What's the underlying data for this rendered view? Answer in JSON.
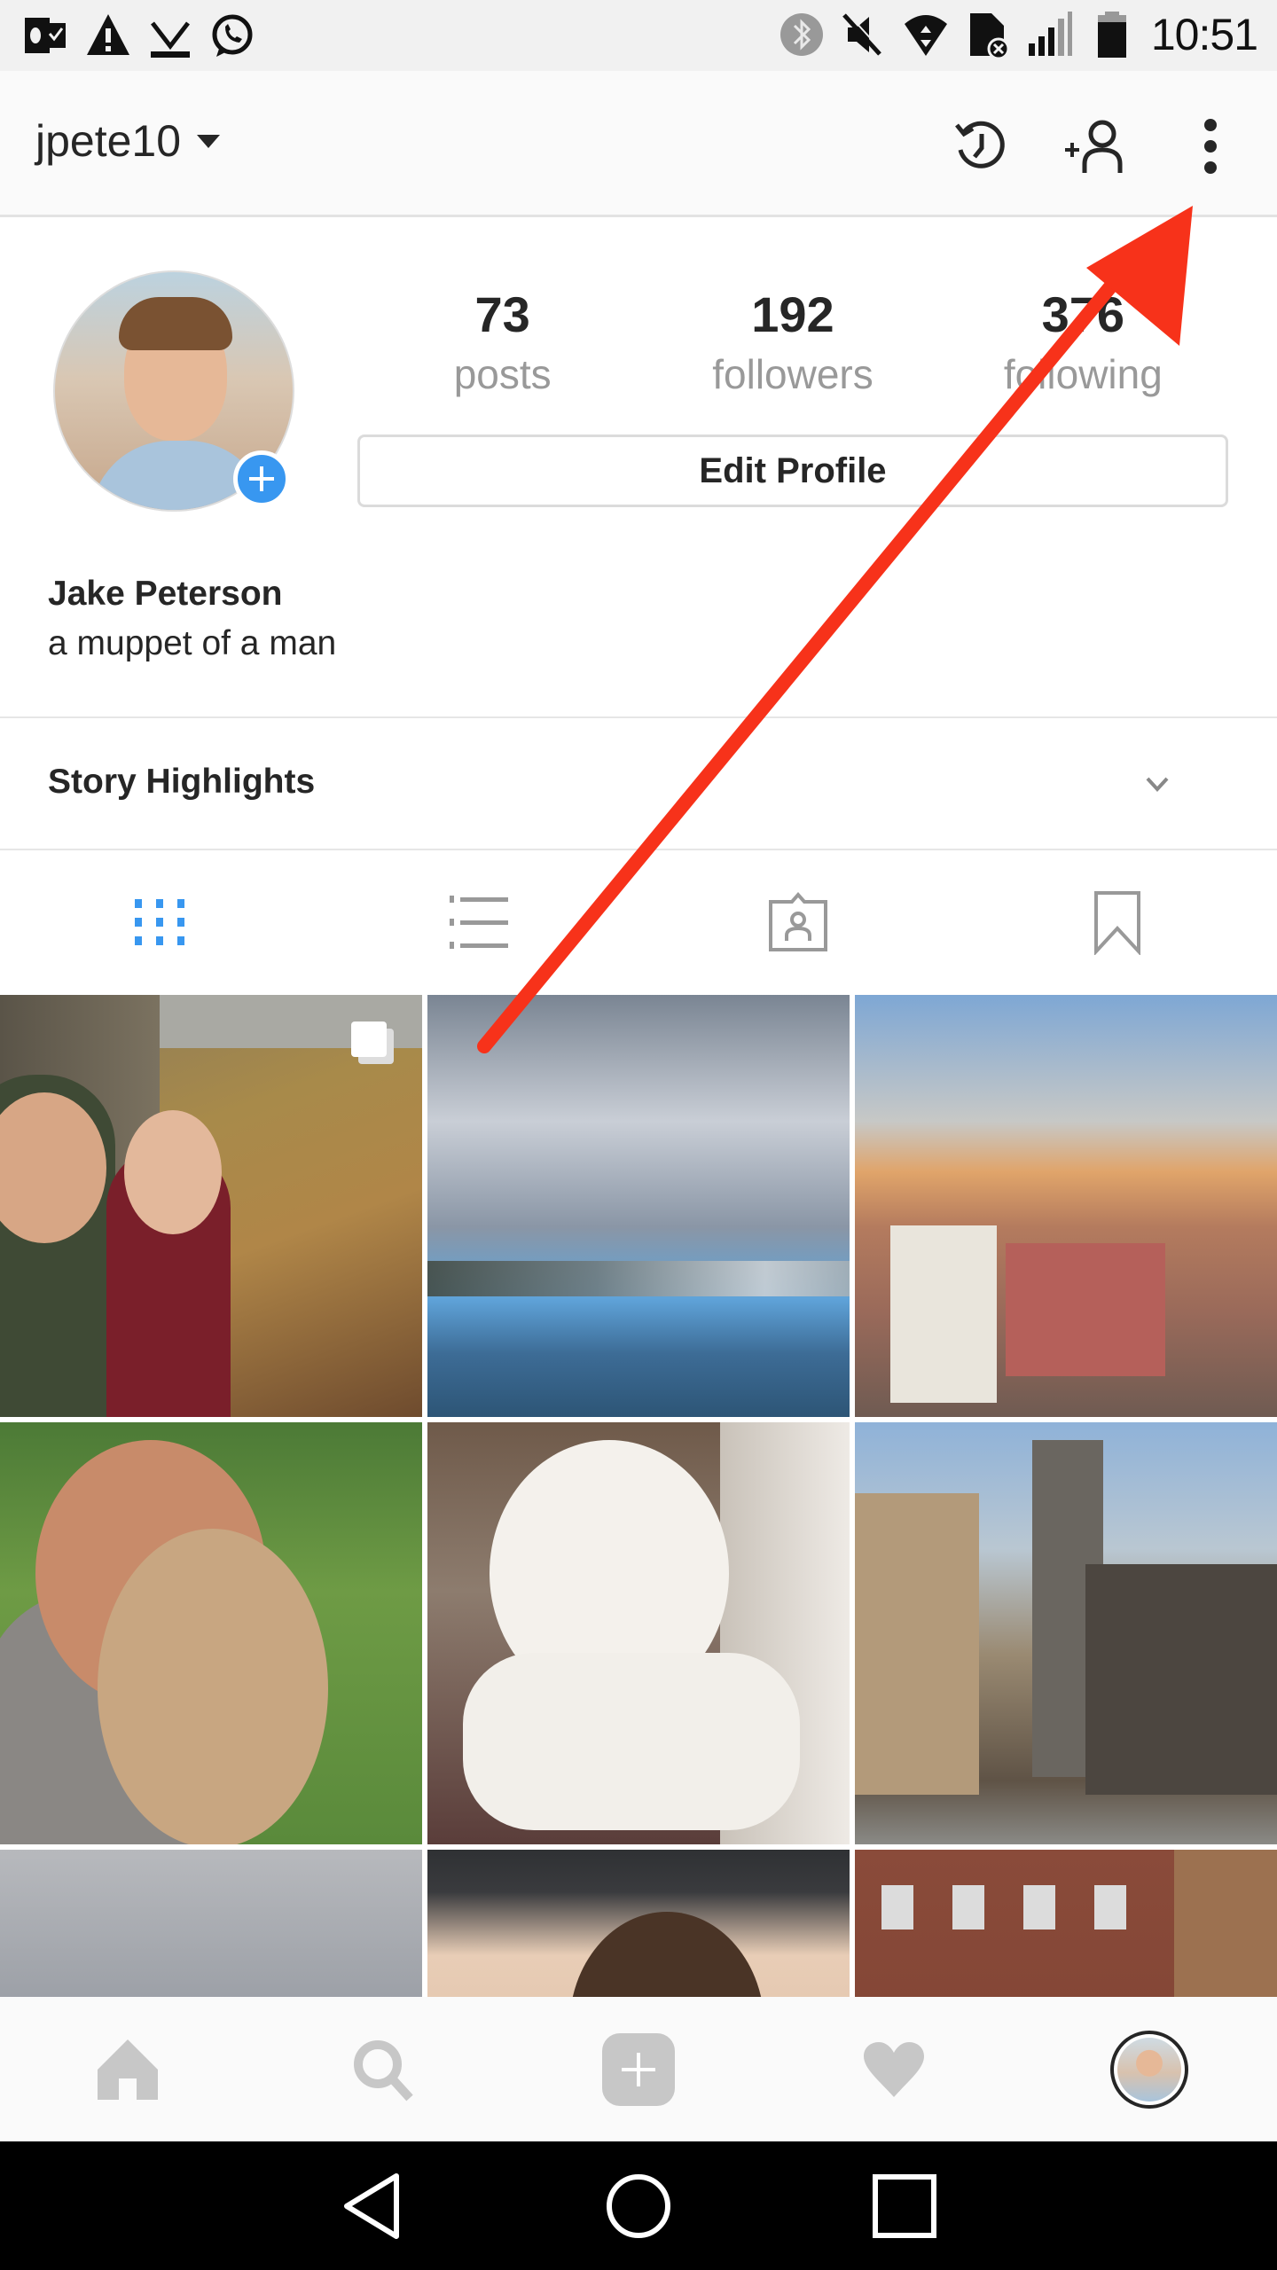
{
  "status_bar": {
    "time": "10:51",
    "left_icons": [
      "outlook-icon",
      "warning-icon",
      "download-done-icon",
      "whatsapp-icon"
    ],
    "right_icons": [
      "bluetooth-icon",
      "mute-icon",
      "wifi-icon",
      "no-sim-icon",
      "signal-icon",
      "battery-icon"
    ]
  },
  "header": {
    "username": "jpete10",
    "icons": [
      "history-icon",
      "add-person-icon",
      "more-vertical-icon"
    ]
  },
  "profile": {
    "full_name": "Jake Peterson",
    "bio": "a muppet of a man",
    "stats": [
      {
        "value": "73",
        "label": "posts"
      },
      {
        "value": "192",
        "label": "followers"
      },
      {
        "value": "376",
        "label": "following"
      }
    ],
    "edit_button": "Edit Profile",
    "accent_color": "#3897f0"
  },
  "story_highlights": {
    "label": "Story Highlights"
  },
  "tabs": [
    {
      "name": "grid",
      "active": true
    },
    {
      "name": "list",
      "active": false
    },
    {
      "name": "tagged",
      "active": false
    },
    {
      "name": "saved",
      "active": false
    }
  ],
  "grid": {
    "posts": [
      {
        "subject": "couple selfie in autumn leaves",
        "multi": true
      },
      {
        "subject": "cloudy harbor"
      },
      {
        "subject": "city skyline at sunset"
      },
      {
        "subject": "woman with fluffy dog"
      },
      {
        "subject": "white poodle"
      },
      {
        "subject": "city street buildings"
      },
      {
        "subject": "clouds"
      },
      {
        "subject": "woman portrait"
      },
      {
        "subject": "brick building"
      }
    ]
  },
  "bottom_nav": [
    "home-icon",
    "search-icon",
    "add-post-icon",
    "activity-heart-icon",
    "profile-avatar"
  ],
  "system_nav": [
    "back-button",
    "home-button",
    "recents-button"
  ],
  "annotation": {
    "color": "#f7321a",
    "target": "more-vertical-icon"
  }
}
